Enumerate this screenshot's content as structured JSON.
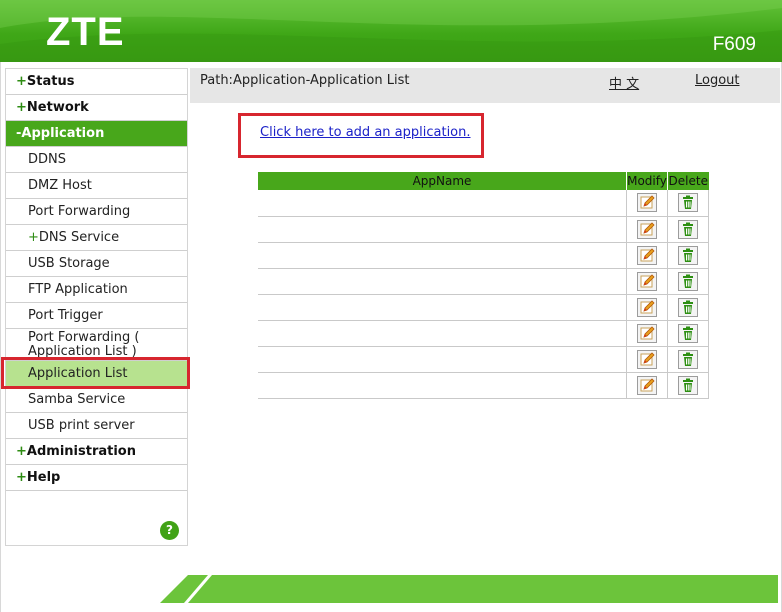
{
  "header": {
    "logo": "ZTE",
    "model": "F609"
  },
  "pathbar": {
    "path": "Path:Application-Application List",
    "language": "中 文",
    "logout": "Logout"
  },
  "sidebar": {
    "items": [
      {
        "label": "Status",
        "prefix": "+",
        "level": "top"
      },
      {
        "label": "Network",
        "prefix": "+",
        "level": "top"
      },
      {
        "label": "Application",
        "prefix": "-",
        "level": "top",
        "active": true
      },
      {
        "label": "DDNS",
        "prefix": "",
        "level": "sub"
      },
      {
        "label": "DMZ Host",
        "prefix": "",
        "level": "sub"
      },
      {
        "label": "Port Forwarding",
        "prefix": "",
        "level": "sub"
      },
      {
        "label": "DNS Service",
        "prefix": "+",
        "level": "sub"
      },
      {
        "label": "USB Storage",
        "prefix": "",
        "level": "sub"
      },
      {
        "label": "FTP Application",
        "prefix": "",
        "level": "sub"
      },
      {
        "label": "Port Trigger",
        "prefix": "",
        "level": "sub"
      },
      {
        "label": "Port Forwarding ( Application List )",
        "prefix": "",
        "level": "sub"
      },
      {
        "label": "Application List",
        "prefix": "",
        "level": "sub",
        "selected": true
      },
      {
        "label": "Samba Service",
        "prefix": "",
        "level": "sub"
      },
      {
        "label": "USB print server",
        "prefix": "",
        "level": "sub"
      },
      {
        "label": "Administration",
        "prefix": "+",
        "level": "top"
      },
      {
        "label": "Help",
        "prefix": "+",
        "level": "top"
      }
    ],
    "help_icon": "?"
  },
  "main": {
    "add_link": "Click here to add an application.",
    "table": {
      "columns": [
        "AppName",
        "Modify",
        "Delete"
      ],
      "rows": [
        "",
        "",
        "",
        "",
        "",
        "",
        "",
        ""
      ],
      "modify_icon": "edit-pencil-icon",
      "delete_icon": "trash-bin-icon"
    }
  },
  "colors": {
    "brand_green": "#48a71b",
    "selected_bg": "#b7e28f",
    "highlight_red": "#d7262f",
    "link_blue": "#1b21c8"
  }
}
